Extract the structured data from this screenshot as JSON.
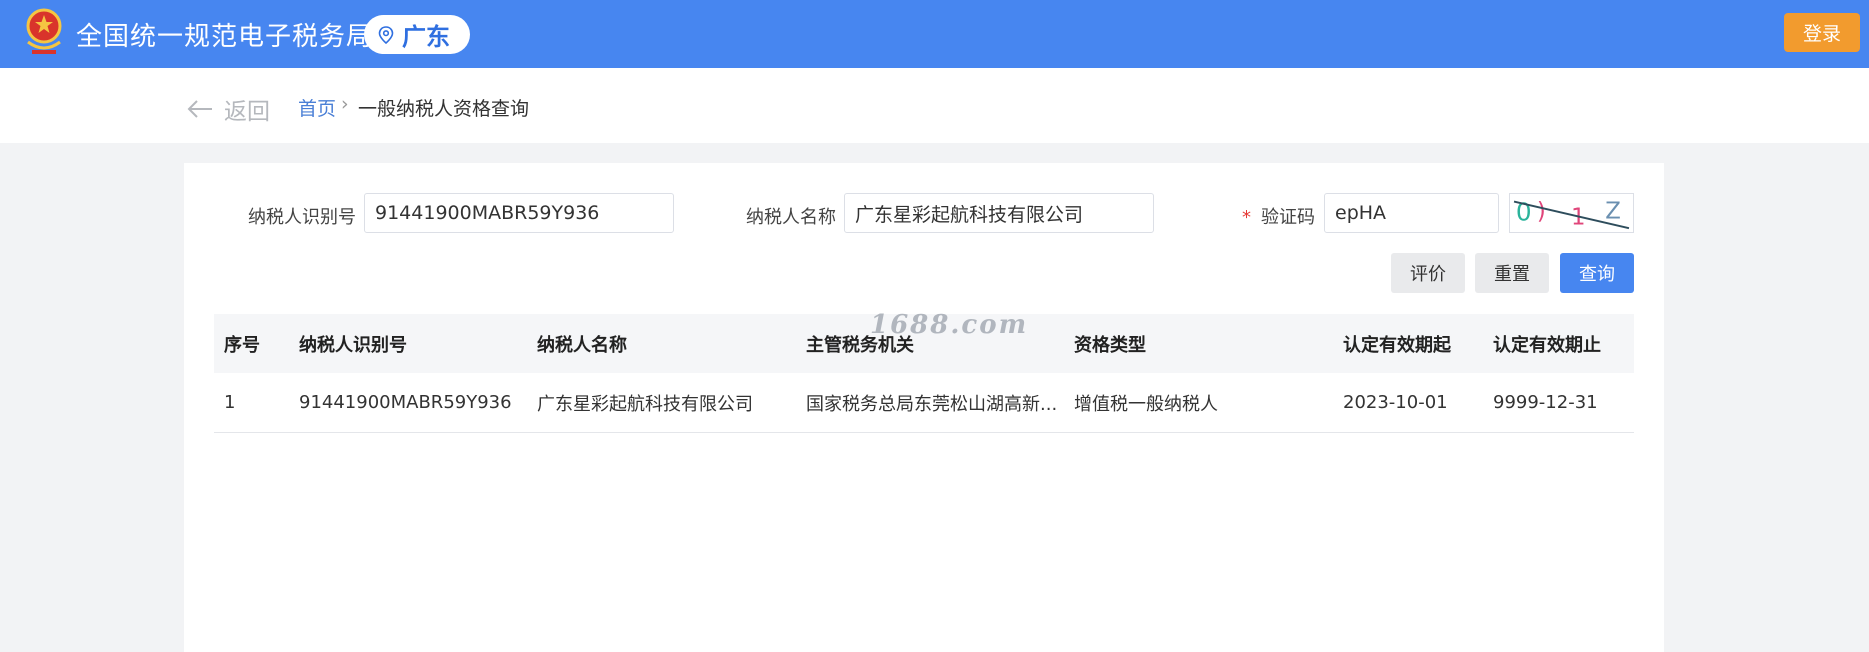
{
  "header": {
    "site_title": "全国统一规范电子税务局",
    "region": "广东",
    "login_label": "登录"
  },
  "breadcrumb": {
    "back_label": "返回",
    "home_label": "首页",
    "separator": "›",
    "current": "一般纳税人资格查询"
  },
  "search": {
    "taxpayer_id_label": "纳税人识别号",
    "taxpayer_id_value": "91441900MABR59Y936",
    "taxpayer_name_label": "纳税人名称",
    "taxpayer_name_value": "广东星彩起航科技有限公司",
    "captcha_required_mark": "*",
    "captcha_label": "验证码",
    "captcha_value": "epHA",
    "captcha_image_text": "0)1Z"
  },
  "actions": {
    "evaluate_label": "评价",
    "reset_label": "重置",
    "query_label": "查询"
  },
  "table": {
    "columns": [
      "序号",
      "纳税人识别号",
      "纳税人名称",
      "主管税务机关",
      "资格类型",
      "认定有效期起",
      "认定有效期止"
    ],
    "rows": [
      [
        "1",
        "91441900MABR59Y936",
        "广东星彩起航科技有限公司",
        "国家税务总局东莞松山湖高新...",
        "增值税一般纳税人",
        "2023-10-01",
        "9999-12-31"
      ]
    ]
  },
  "watermark": "1688.com",
  "colors": {
    "header_bg": "#4786f0",
    "login_bg": "#f29b2e",
    "query_bg": "#4786f0",
    "link": "#4a7fd6"
  }
}
